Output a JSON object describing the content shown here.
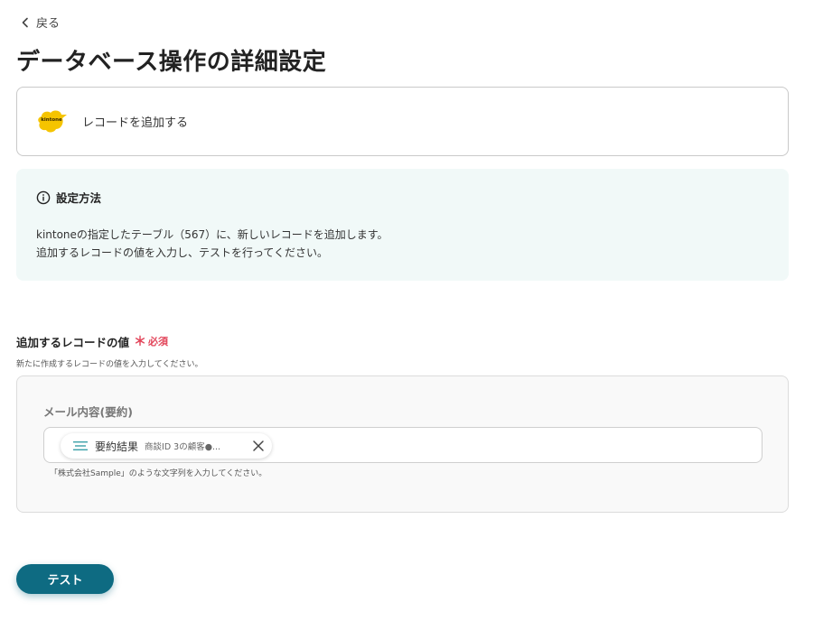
{
  "nav": {
    "back_label": "戻る"
  },
  "page": {
    "title": "データベース操作の詳細設定"
  },
  "app": {
    "logo_text": "kintone",
    "brand_color": "#f5c400",
    "action_label": "レコードを追加する"
  },
  "info": {
    "heading": "設定方法",
    "line1": "kintoneの指定したテーブル（567）に、新しいレコードを追加します。",
    "line2": "追加するレコードの値を入力し、テストを行ってください。"
  },
  "field": {
    "label": "追加するレコードの値",
    "required_mark": "＊",
    "required_text": "必須",
    "hint": "新たに作成するレコードの値を入力してください。",
    "inner_label": "メール内容(要約)",
    "chip": {
      "icon": "text-lines-icon",
      "name": "要約結果",
      "sub": "商談ID 3の顧客●..."
    },
    "input_hint": "「株式会社Sample」のような文字列を入力してください。"
  },
  "actions": {
    "test_label": "テスト",
    "accent": "#0e6b82"
  }
}
